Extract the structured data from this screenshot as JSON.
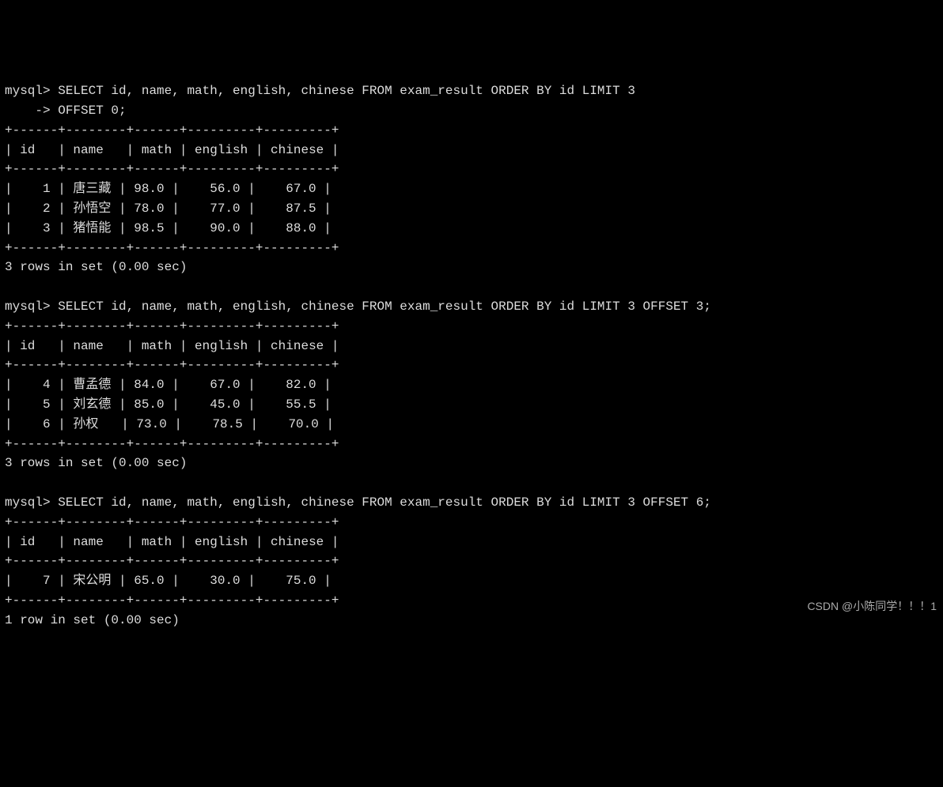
{
  "prompt": "mysql>",
  "cont_prompt": "    ->",
  "queries": [
    {
      "sql_lines": [
        "SELECT id, name, math, english, chinese FROM exam_result ORDER BY id LIMIT 3",
        "OFFSET 0;"
      ],
      "columns": [
        "id",
        "name",
        "math",
        "english",
        "chinese"
      ],
      "rows": [
        {
          "id": 1,
          "name": "唐三藏",
          "math": "98.0",
          "english": "56.0",
          "chinese": "67.0"
        },
        {
          "id": 2,
          "name": "孙悟空",
          "math": "78.0",
          "english": "77.0",
          "chinese": "87.5"
        },
        {
          "id": 3,
          "name": "猪悟能",
          "math": "98.5",
          "english": "90.0",
          "chinese": "88.0"
        }
      ],
      "status": "3 rows in set (0.00 sec)"
    },
    {
      "sql_lines": [
        "SELECT id, name, math, english, chinese FROM exam_result ORDER BY id LIMIT 3 OFFSET 3;"
      ],
      "columns": [
        "id",
        "name",
        "math",
        "english",
        "chinese"
      ],
      "rows": [
        {
          "id": 4,
          "name": "曹孟德",
          "math": "84.0",
          "english": "67.0",
          "chinese": "82.0"
        },
        {
          "id": 5,
          "name": "刘玄德",
          "math": "85.0",
          "english": "45.0",
          "chinese": "55.5"
        },
        {
          "id": 6,
          "name": "孙权",
          "math": "73.0",
          "english": "78.5",
          "chinese": "70.0"
        }
      ],
      "status": "3 rows in set (0.00 sec)"
    },
    {
      "sql_lines": [
        "SELECT id, name, math, english, chinese FROM exam_result ORDER BY id LIMIT 3 OFFSET 6;"
      ],
      "columns": [
        "id",
        "name",
        "math",
        "english",
        "chinese"
      ],
      "rows": [
        {
          "id": 7,
          "name": "宋公明",
          "math": "65.0",
          "english": "30.0",
          "chinese": "75.0"
        }
      ],
      "status": "1 row in set (0.00 sec)"
    }
  ],
  "table_layout": {
    "border_line": "+------+--------+------+---------+---------+",
    "col_widths": {
      "id": 4,
      "name": 6,
      "math": 4,
      "english": 7,
      "chinese": 7
    }
  },
  "watermark": "CSDN @小陈同学！！！1"
}
